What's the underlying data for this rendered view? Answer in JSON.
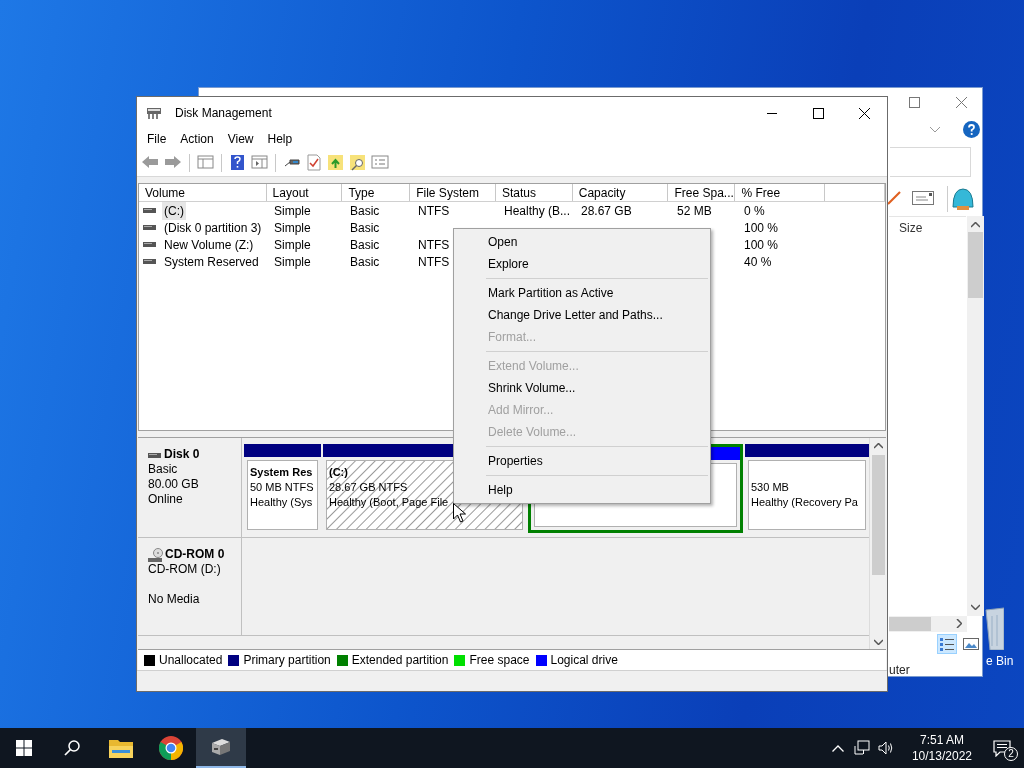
{
  "background_window": {
    "size_column": "Size",
    "status_text": "uter",
    "view_buttons": [
      {
        "selected": true
      },
      {
        "selected": false
      }
    ]
  },
  "desktop_icons": [
    {
      "label": "e Bin"
    }
  ],
  "window": {
    "title": "Disk Management"
  },
  "menu": [
    "File",
    "Action",
    "View",
    "Help"
  ],
  "volume_list": {
    "columns": [
      "Volume",
      "Layout",
      "Type",
      "File System",
      "Status",
      "Capacity",
      "Free Spa...",
      "% Free"
    ],
    "rows": [
      {
        "selected": true,
        "cells": [
          "(C:)",
          "Simple",
          "Basic",
          "NTFS",
          "Healthy (B...",
          "28.67 GB",
          "52 MB",
          "0 %"
        ]
      },
      {
        "selected": false,
        "cells": [
          "(Disk 0 partition 3)",
          "Simple",
          "Basic",
          null,
          null,
          null,
          null,
          "100 %"
        ]
      },
      {
        "selected": false,
        "cells": [
          "New Volume (Z:)",
          "Simple",
          "Basic",
          "NTFS",
          null,
          null,
          null,
          "100 %"
        ]
      },
      {
        "selected": false,
        "cells": [
          "System Reserved",
          "Simple",
          "Basic",
          "NTFS",
          null,
          null,
          null,
          "40 %"
        ]
      }
    ]
  },
  "disks": [
    {
      "kind": "disk",
      "name": "Disk 0",
      "lines": [
        "Basic",
        "80.00 GB",
        "Online"
      ],
      "partitions": [
        {
          "kind": "primary",
          "title": "System Res",
          "lines": [
            "50 MB NTFS",
            "Healthy (Sys"
          ],
          "hatched": false
        },
        {
          "kind": "primary",
          "title": "(C:)",
          "lines": [
            "28.67 GB NTFS",
            "Healthy (Boot, Page File"
          ],
          "hatched": true
        },
        {
          "kind": "logical",
          "hatched": false
        },
        {
          "kind": "primary",
          "lines": [
            "530 MB",
            "Healthy (Recovery Pa"
          ],
          "hatched": false
        }
      ]
    },
    {
      "kind": "cdrom",
      "name": "CD-ROM 0",
      "lines": [
        "CD-ROM (D:)"
      ],
      "status": "No Media"
    }
  ],
  "legend": [
    {
      "label": "Unallocated",
      "color": "#000000"
    },
    {
      "label": "Primary partition",
      "color": "#000080"
    },
    {
      "label": "Extended partition",
      "color": "#008000"
    },
    {
      "label": "Free space",
      "color": "#00e000"
    },
    {
      "label": "Logical drive",
      "color": "#0000ff"
    }
  ],
  "context_menu": [
    {
      "kind": "item",
      "label": "Open",
      "disabled": false
    },
    {
      "kind": "item",
      "label": "Explore",
      "disabled": false
    },
    {
      "kind": "separator"
    },
    {
      "kind": "item",
      "label": "Mark Partition as Active",
      "disabled": false
    },
    {
      "kind": "item",
      "label": "Change Drive Letter and Paths...",
      "disabled": false
    },
    {
      "kind": "item",
      "label": "Format...",
      "disabled": true
    },
    {
      "kind": "separator"
    },
    {
      "kind": "item",
      "label": "Extend Volume...",
      "disabled": true
    },
    {
      "kind": "item",
      "label": "Shrink Volume...",
      "disabled": false
    },
    {
      "kind": "item",
      "label": "Add Mirror...",
      "disabled": true
    },
    {
      "kind": "item",
      "label": "Delete Volume...",
      "disabled": true
    },
    {
      "kind": "separator"
    },
    {
      "kind": "item",
      "label": "Properties",
      "disabled": false
    },
    {
      "kind": "separator"
    },
    {
      "kind": "item",
      "label": "Help",
      "disabled": false
    }
  ],
  "taskbar": {
    "apps": [
      {
        "kind": "start",
        "selected": false
      },
      {
        "kind": "search",
        "selected": false
      },
      {
        "kind": "folder",
        "selected": false
      },
      {
        "kind": "browser",
        "selected": false
      },
      {
        "kind": "disk",
        "selected": true
      }
    ],
    "time": "7:51 AM",
    "date": "10/13/2022",
    "notifications": "2"
  }
}
